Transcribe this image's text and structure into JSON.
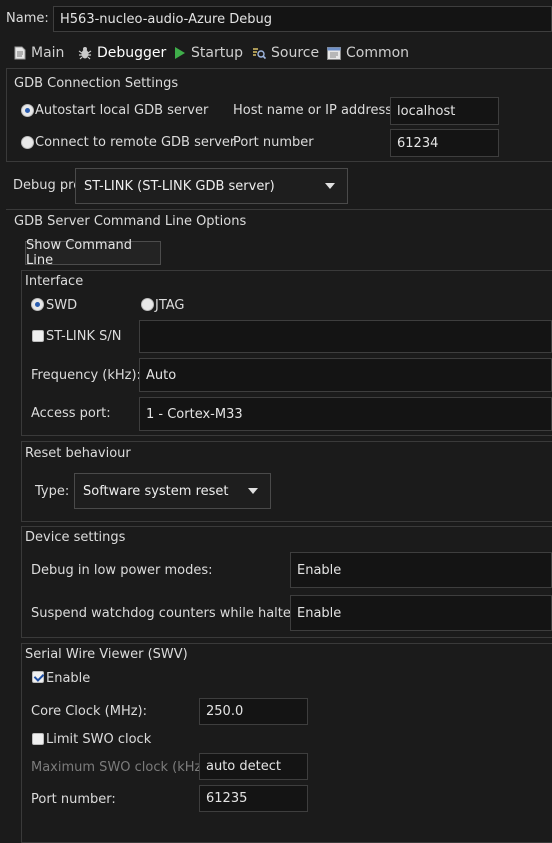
{
  "name": {
    "label": "Name:",
    "value": "H563-nucleo-audio-Azure Debug"
  },
  "tabs": [
    {
      "label": "Main",
      "icon": "document-icon"
    },
    {
      "label": "Debugger",
      "icon": "debug-bug-icon"
    },
    {
      "label": "Startup",
      "icon": "play-icon"
    },
    {
      "label": "Source",
      "icon": "source-lookup-icon"
    },
    {
      "label": "Common",
      "icon": "common-tab-icon"
    }
  ],
  "gdb_connection": {
    "title": "GDB Connection Settings",
    "autostart_label": "Autostart local GDB server",
    "remote_label": "Connect to remote GDB server",
    "host_label": "Host name or IP address",
    "host_value": "localhost",
    "port_label": "Port number",
    "port_value": "61234"
  },
  "debug_probe": {
    "label": "Debug probe",
    "value": "ST-LINK (ST-LINK GDB server)"
  },
  "server_options": {
    "title": "GDB Server Command Line Options",
    "show_cmd_label": "Show Command Line"
  },
  "interface": {
    "title": "Interface",
    "swd_label": "SWD",
    "jtag_label": "JTAG",
    "stlink_sn_label": "ST-LINK S/N",
    "stlink_sn_value": "",
    "freq_label": "Frequency (kHz):",
    "freq_value": "Auto",
    "access_port_label": "Access port:",
    "access_port_value": "1 - Cortex-M33"
  },
  "reset": {
    "title": "Reset behaviour",
    "type_label": "Type:",
    "type_value": "Software system reset"
  },
  "device": {
    "title": "Device settings",
    "low_power_label": "Debug in low power modes:",
    "low_power_value": "Enable",
    "watchdog_label": "Suspend watchdog counters while halted:",
    "watchdog_value": "Enable"
  },
  "swv": {
    "title": "Serial Wire Viewer (SWV)",
    "enable_label": "Enable",
    "core_clock_label": "Core Clock (MHz):",
    "core_clock_value": "250.0",
    "limit_swo_label": "Limit SWO clock",
    "max_swo_label": "Maximum SWO clock (kHz):",
    "max_swo_value": "auto detect",
    "port_label": "Port number:",
    "port_value": "61235"
  },
  "colors": {
    "background": "#1b1b1b",
    "field_background": "#141414",
    "border": "#3a3a3a",
    "text": "#dcdcdc",
    "play_icon": "#3fae4a",
    "radio_selected": "#2a5db0"
  }
}
